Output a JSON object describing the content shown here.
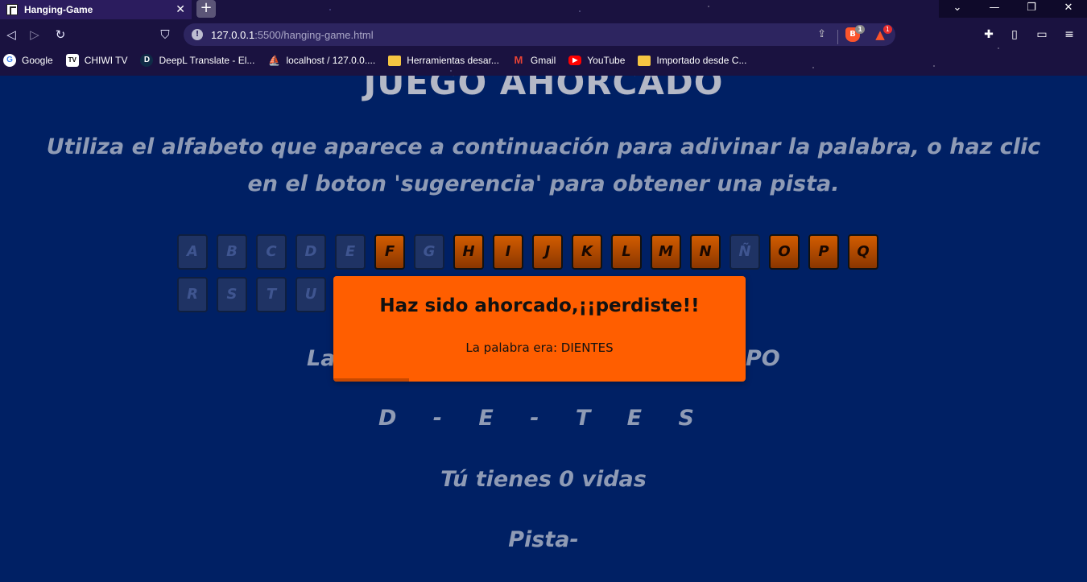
{
  "browser": {
    "tab_title": "Hanging-Game",
    "tab_close": "✕",
    "new_tab": "+",
    "url_host": "127.0.0.1",
    "url_path": ":5500/hanging-game.html",
    "shield_count": "1",
    "rewards_count": "1",
    "window_controls": {
      "tab_search": "⌄",
      "minimize": "—",
      "maximize": "❐",
      "close": "✕"
    }
  },
  "bookmarks": [
    {
      "label": "Google",
      "icon": "google-icon"
    },
    {
      "label": "CHIWI TV",
      "icon": "tv-icon"
    },
    {
      "label": "DeepL Translate - El...",
      "icon": "deepl-icon"
    },
    {
      "label": "localhost / 127.0.0....",
      "icon": "phpmyadmin-icon"
    },
    {
      "label": "Herramientas desar...",
      "icon": "folder-icon"
    },
    {
      "label": "Gmail",
      "icon": "gmail-icon"
    },
    {
      "label": "YouTube",
      "icon": "youtube-icon"
    },
    {
      "label": "Importado desde C...",
      "icon": "folder-icon"
    }
  ],
  "game": {
    "title": "JUEGO AHORCADO",
    "instructions": "Utiliza el alfabeto que aparece a continuación para adivinar la palabra, o haz clic en el boton 'sugerencia' para obtener una pista.",
    "letters_row1": [
      "A",
      "B",
      "C",
      "D",
      "E",
      "F",
      "G",
      "H",
      "I",
      "J",
      "K",
      "L",
      "M",
      "N",
      "Ñ",
      "O",
      "P",
      "Q"
    ],
    "letters_row2": [
      "R",
      "S",
      "T",
      "U"
    ],
    "used_letters": [
      "A",
      "B",
      "C",
      "D",
      "E",
      "G",
      "Ñ",
      "R",
      "S",
      "T",
      "U"
    ],
    "mystery_left": "La",
    "mystery_right": "PO",
    "word_display": "D - E - T E S",
    "lives": "Tú tienes 0 vidas",
    "hint": "Pista-"
  },
  "modal": {
    "title": "Haz sido ahorcado,¡¡perdiste!!",
    "text": "La palabra era: DIENTES"
  },
  "colors": {
    "page_bg": "#002064",
    "modal_bg": "#ff5e00",
    "letter_available": "#d25c00",
    "letter_used": "#1f3364"
  }
}
